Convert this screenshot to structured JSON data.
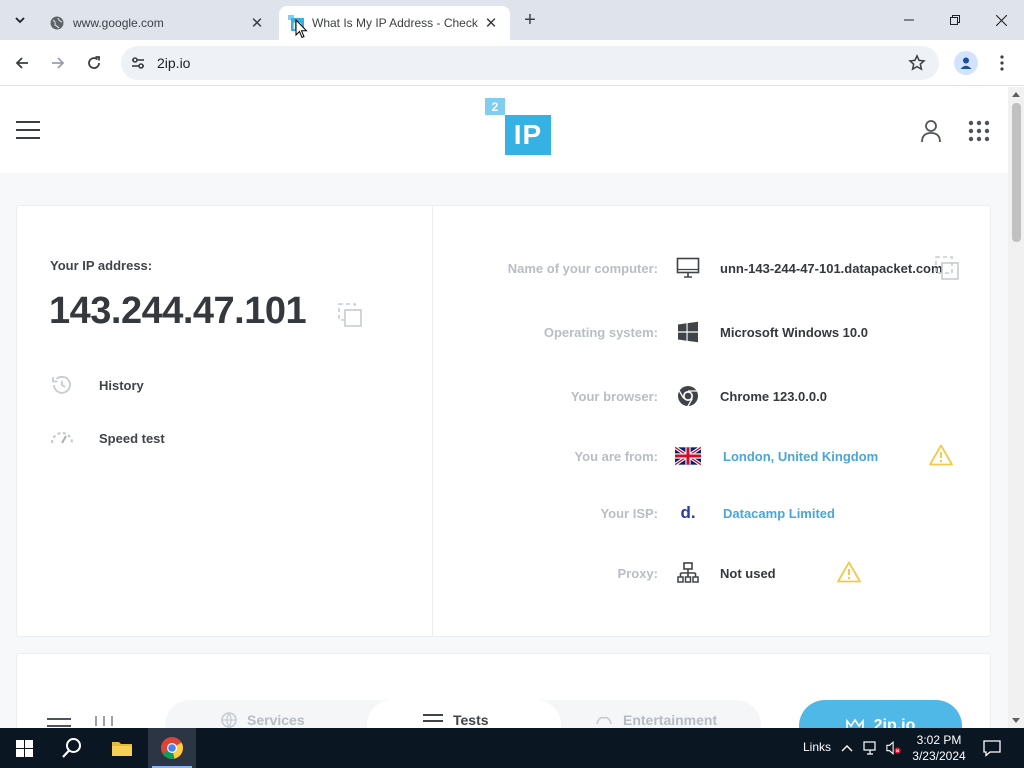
{
  "browser": {
    "tabs": [
      {
        "title": "www.google.com",
        "active": false
      },
      {
        "title": "What Is My IP Address - Check",
        "active": true
      }
    ],
    "address": "2ip.io"
  },
  "site": {
    "logo": {
      "badge_small": "2",
      "badge_main": "IP"
    },
    "ip_label": "Your IP address:",
    "ip_value": "143.244.47.101",
    "side_links": [
      {
        "label": "History",
        "icon": "history-icon"
      },
      {
        "label": "Speed test",
        "icon": "speedometer-icon"
      }
    ],
    "info": [
      {
        "key": "Name of your computer:",
        "value": "unn-143-244-47-101.datapacket.com",
        "icon": "monitor-icon",
        "link": false
      },
      {
        "key": "Operating system:",
        "value": "Microsoft Windows 10.0",
        "icon": "windows-icon",
        "link": false
      },
      {
        "key": "Your browser:",
        "value": "Chrome 123.0.0.0",
        "icon": "chrome-icon",
        "link": false
      },
      {
        "key": "You are from:",
        "value": "London, United Kingdom",
        "icon": "uk-flag-icon",
        "link": true
      },
      {
        "key": "Your ISP:",
        "value": "Datacamp Limited",
        "icon": "isp-logo-icon",
        "link": true,
        "icon_text": "d."
      },
      {
        "key": "Proxy:",
        "value": "Not used",
        "icon": "network-icon",
        "link": false
      }
    ],
    "bottom_nav": {
      "items": [
        "Services",
        "Tests",
        "Entertainment"
      ],
      "active": "Tests",
      "cta": "2ip.io"
    }
  },
  "taskbar": {
    "links_label": "Links",
    "time": "3:02 PM",
    "date": "3/23/2024"
  },
  "colors": {
    "accent": "#35b1e3",
    "link": "#4aa6d6",
    "warning": "#f2c94c"
  }
}
